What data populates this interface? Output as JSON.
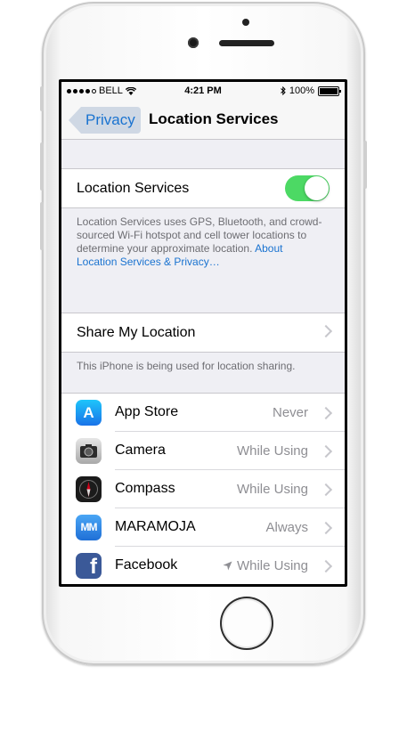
{
  "status_bar": {
    "carrier": "BELL",
    "time": "4:21 PM",
    "battery": "100%"
  },
  "nav": {
    "back_label": "Privacy",
    "title": "Location Services"
  },
  "location_services": {
    "label": "Location Services",
    "enabled": true,
    "footer_text": "Location Services uses GPS, Bluetooth, and crowd-sourced Wi-Fi hotspot and cell tower locations to determine your approximate location.",
    "footer_link": "About Location Services & Privacy…"
  },
  "share": {
    "label": "Share My Location",
    "footer_text": "This iPhone is being used for location sharing."
  },
  "apps": [
    {
      "name": "App Store",
      "value": "Never",
      "icon": "app-store-icon"
    },
    {
      "name": "Camera",
      "value": "While Using",
      "icon": "camera-app-icon"
    },
    {
      "name": "Compass",
      "value": "While Using",
      "icon": "compass-app-icon"
    },
    {
      "name": "MARAMOJA",
      "value": "Always",
      "icon": "maramoja-app-icon"
    },
    {
      "name": "Facebook",
      "value": "While Using",
      "icon": "facebook-app-icon",
      "location_arrow": true
    }
  ],
  "colors": {
    "accent": "#1a73d0",
    "toggle_on": "#4cd964",
    "background": "#efeff4"
  }
}
